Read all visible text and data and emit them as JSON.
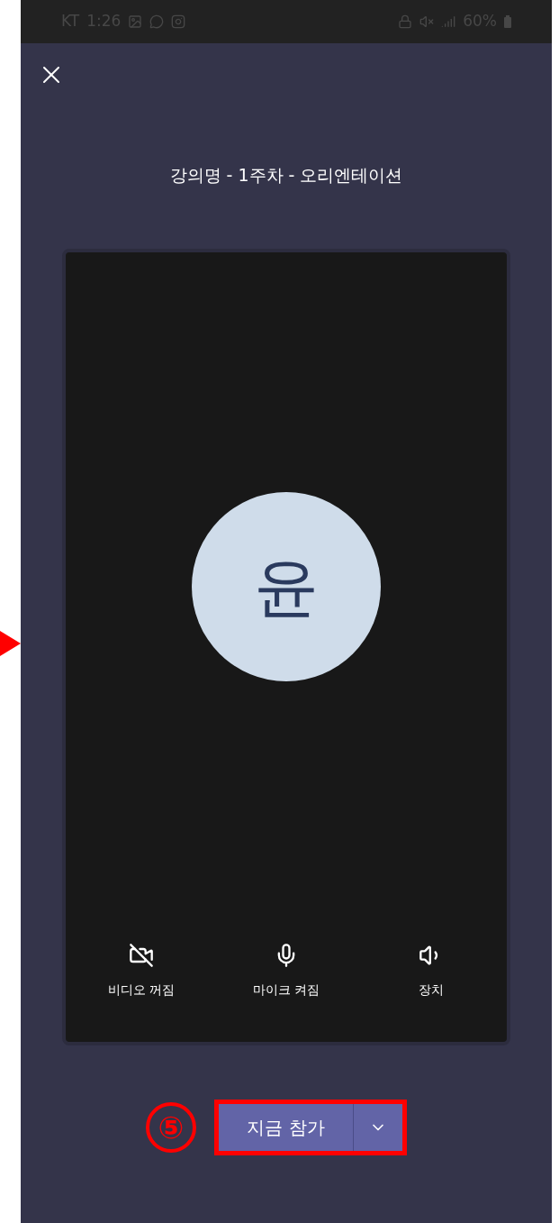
{
  "status_bar": {
    "carrier": "KT",
    "time": "1:26",
    "battery": "60%"
  },
  "meeting_title": "강의명 - 1주차 - 오리엔테이션",
  "avatar": {
    "initial": "윤"
  },
  "controls": [
    {
      "kind": "video",
      "label": "비디오 꺼짐",
      "on": false
    },
    {
      "kind": "mic",
      "label": "마이크 켜짐",
      "on": true
    },
    {
      "kind": "device",
      "label": "장치"
    }
  ],
  "join_button": {
    "label": "지금 참가"
  },
  "annotation": {
    "step": "⑤"
  }
}
